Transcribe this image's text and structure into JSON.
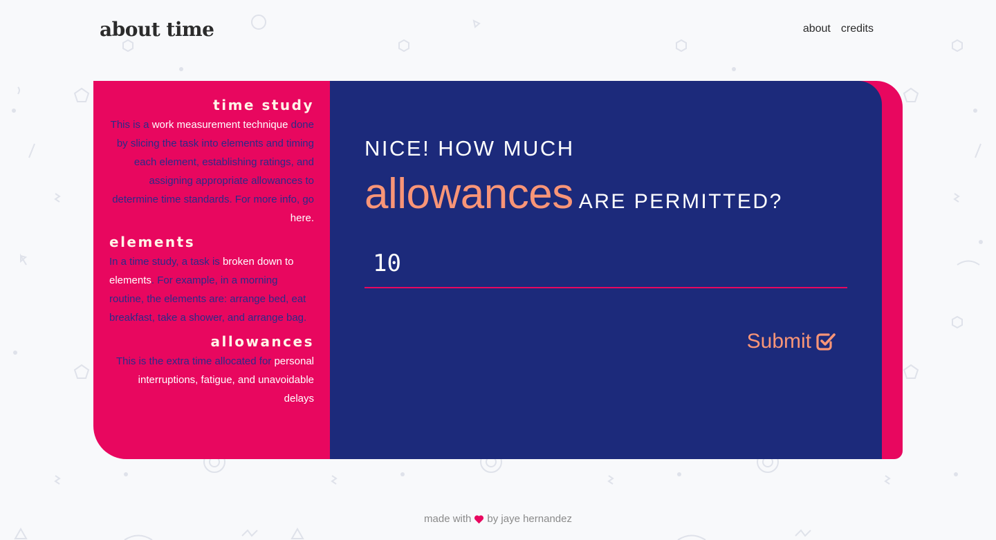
{
  "header": {
    "title": "about time",
    "nav": [
      {
        "label": "about"
      },
      {
        "label": "credits"
      }
    ]
  },
  "sidebar": {
    "sections": [
      {
        "heading": "time study",
        "parts": [
          {
            "text": "This is a ",
            "em": false
          },
          {
            "text": "work measurement technique",
            "em": true
          },
          {
            "text": " done by slicing the task into elements and timing each element, establishing ratings, and assigning appropriate allowances to determine time standards. For more info, go ",
            "em": false
          },
          {
            "text": "here.",
            "em": true
          }
        ]
      },
      {
        "heading": "elements",
        "parts": [
          {
            "text": "In a time study, a task is ",
            "em": false
          },
          {
            "text": "broken down to elements",
            "em": true
          },
          {
            "text": ". For example, in a morning routine, the elements are: arrange bed, eat breakfast, take a shower, and arrange bag.",
            "em": false
          }
        ]
      },
      {
        "heading": "allowances",
        "parts": [
          {
            "text": "This is the extra time allocated for ",
            "em": false
          },
          {
            "text": "personal interruptions, fatigue, and unavoidable delays",
            "em": true
          }
        ]
      }
    ]
  },
  "question": {
    "line1": "NICE! HOW MUCH",
    "highlight": "allowances",
    "rest": "ARE PERMITTED?",
    "input_value": "10"
  },
  "submit": {
    "label": "Submit",
    "icon": "check-square-icon"
  },
  "footer": {
    "prefix": "made with",
    "suffix": "by jaye hernandez",
    "icon": "heart-icon"
  },
  "colors": {
    "page_bg": "#f8f9fb",
    "accent_pink": "#e8075f",
    "panel_navy": "#1c2a7b",
    "salmon": "#f99577",
    "sidebar_text": "#2a2b88",
    "heading_cream": "#fff4e8"
  }
}
